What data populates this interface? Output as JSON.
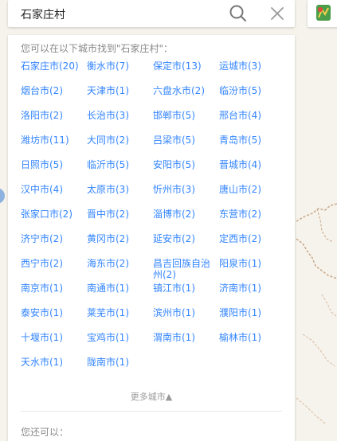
{
  "search": {
    "query": "石家庄村"
  },
  "results": {
    "title": "您可以在以下城市找到\"石家庄村\"：",
    "cities": [
      "石家庄市(20)",
      "衡水市(7)",
      "保定市(13)",
      "运城市(3)",
      "烟台市(2)",
      "天津市(1)",
      "六盘水市(2)",
      "临汾市(5)",
      "洛阳市(2)",
      "长治市(3)",
      "邯郸市(5)",
      "邢台市(4)",
      "潍坊市(11)",
      "大同市(2)",
      "吕梁市(5)",
      "青岛市(5)",
      "日照市(5)",
      "临沂市(5)",
      "安阳市(5)",
      "晋城市(4)",
      "汉中市(4)",
      "太原市(3)",
      "忻州市(3)",
      "唐山市(2)",
      "张家口市(2)",
      "晋中市(2)",
      "淄博市(2)",
      "东营市(2)",
      "济宁市(2)",
      "黄冈市(2)",
      "延安市(2)",
      "定西市(2)",
      "西宁市(2)",
      "海东市(2)",
      "昌吉回族自治州(2)",
      "阳泉市(1)",
      "南京市(1)",
      "南通市(1)",
      "镇江市(1)",
      "济南市(1)",
      "泰安市(1)",
      "莱芜市(1)",
      "滨州市(1)",
      "濮阳市(1)",
      "十堰市(1)",
      "宝鸡市(1)",
      "渭南市(1)",
      "榆林市(1)",
      "天水市(1)",
      "陇南市(1)"
    ],
    "more_label": "更多城市▲",
    "also_label": "您还可以："
  },
  "colors": {
    "link": "#3385ff",
    "muted": "#888888"
  },
  "icons": {
    "search": "search-icon",
    "close": "close-icon",
    "route": "route-icon"
  }
}
